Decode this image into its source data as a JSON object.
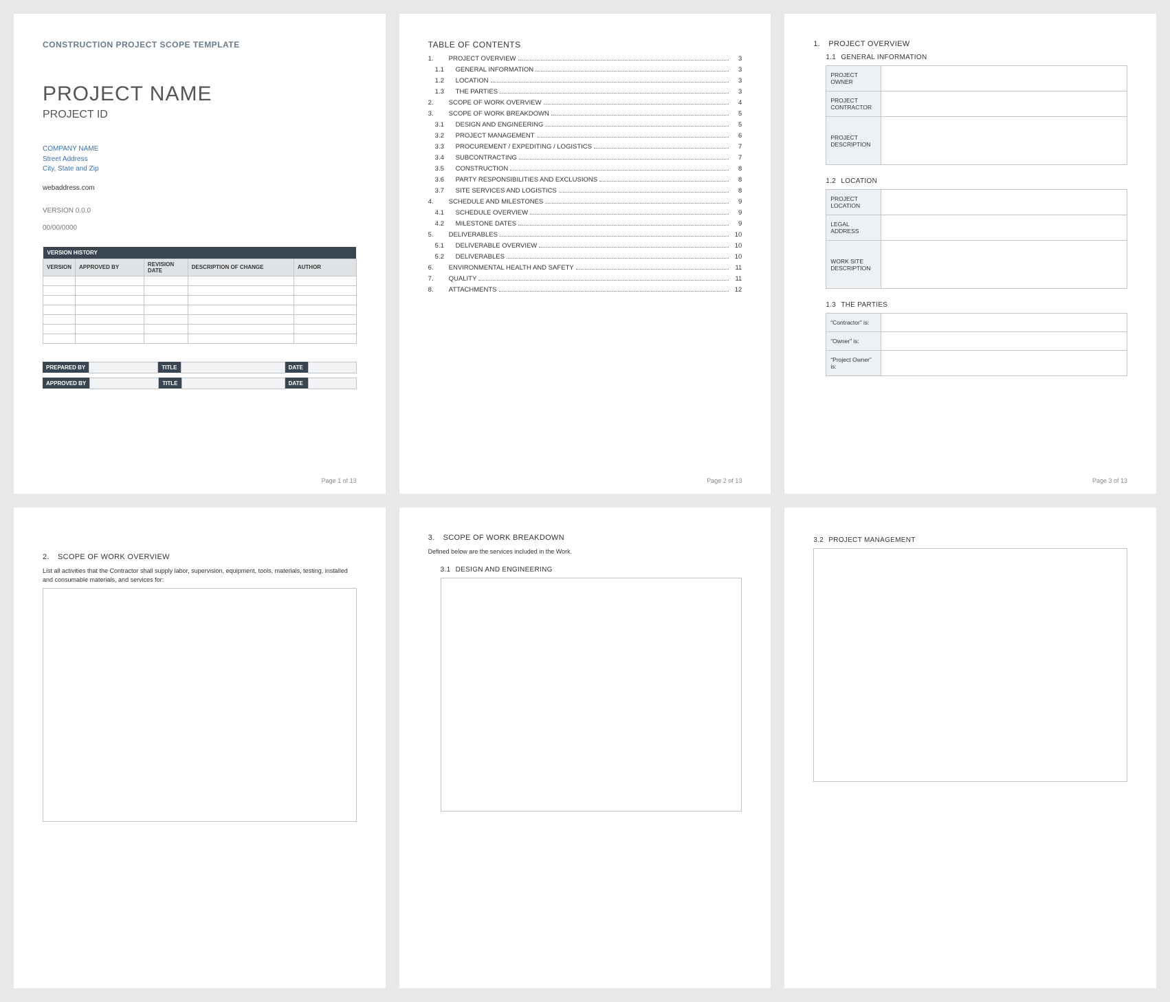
{
  "doc": {
    "type_header": "CONSTRUCTION PROJECT SCOPE TEMPLATE",
    "title": "PROJECT NAME",
    "project_id": "PROJECT ID",
    "company": {
      "name": "COMPANY NAME",
      "street": "Street Address",
      "city_state_zip": "City, State and Zip",
      "web": "webaddress.com"
    },
    "version": "VERSION 0.0.0",
    "date": "00/00/0000",
    "total_pages": 13
  },
  "version_history": {
    "bar": "VERSION HISTORY",
    "cols": [
      "VERSION",
      "APPROVED BY",
      "REVISION DATE",
      "DESCRIPTION OF CHANGE",
      "AUTHOR"
    ],
    "row_count": 7
  },
  "signoff": {
    "rows": [
      {
        "c0": "PREPARED BY",
        "c1": "TITLE",
        "c2": "DATE"
      },
      {
        "c0": "APPROVED BY",
        "c1": "TITLE",
        "c2": "DATE"
      }
    ]
  },
  "toc": {
    "title": "TABLE OF CONTENTS",
    "items": [
      {
        "n": "1.",
        "label": "PROJECT OVERVIEW",
        "pg": "3",
        "lvl": 0
      },
      {
        "n": "1.1",
        "label": "GENERAL INFORMATION",
        "pg": "3",
        "lvl": 1
      },
      {
        "n": "1.2",
        "label": "LOCATION",
        "pg": "3",
        "lvl": 1
      },
      {
        "n": "1.3",
        "label": "THE PARTIES",
        "pg": "3",
        "lvl": 1
      },
      {
        "n": "2.",
        "label": "SCOPE OF WORK OVERVIEW",
        "pg": "4",
        "lvl": 0
      },
      {
        "n": "3.",
        "label": "SCOPE OF WORK BREAKDOWN",
        "pg": "5",
        "lvl": 0
      },
      {
        "n": "3.1",
        "label": "DESIGN AND ENGINEERING",
        "pg": "5",
        "lvl": 1
      },
      {
        "n": "3.2",
        "label": "PROJECT MANAGEMENT",
        "pg": "6",
        "lvl": 1
      },
      {
        "n": "3.3",
        "label": "PROCUREMENT / EXPEDITING / LOGISTICS",
        "pg": "7",
        "lvl": 1
      },
      {
        "n": "3.4",
        "label": "SUBCONTRACTING",
        "pg": "7",
        "lvl": 1
      },
      {
        "n": "3.5",
        "label": "CONSTRUCTION",
        "pg": "8",
        "lvl": 1
      },
      {
        "n": "3.6",
        "label": "PARTY RESPONSIBILITIES AND EXCLUSIONS",
        "pg": "8",
        "lvl": 1
      },
      {
        "n": "3.7",
        "label": "SITE SERVICES AND LOGISTICS",
        "pg": "8",
        "lvl": 1
      },
      {
        "n": "4.",
        "label": "SCHEDULE AND MILESTONES",
        "pg": "9",
        "lvl": 0
      },
      {
        "n": "4.1",
        "label": "SCHEDULE OVERVIEW",
        "pg": "9",
        "lvl": 1
      },
      {
        "n": "4.2",
        "label": "MILESTONE DATES",
        "pg": "9",
        "lvl": 1
      },
      {
        "n": "5.",
        "label": "DELIVERABLES",
        "pg": "10",
        "lvl": 0
      },
      {
        "n": "5.1",
        "label": "DELIVERABLE OVERVIEW",
        "pg": "10",
        "lvl": 1
      },
      {
        "n": "5.2",
        "label": "DELIVERABLES",
        "pg": "10",
        "lvl": 1
      },
      {
        "n": "6.",
        "label": "ENVIRONMENTAL HEALTH AND SAFETY",
        "pg": "11",
        "lvl": 0
      },
      {
        "n": "7.",
        "label": "QUALITY",
        "pg": "11",
        "lvl": 0
      },
      {
        "n": "8.",
        "label": "ATTACHMENTS",
        "pg": "12",
        "lvl": 0
      }
    ]
  },
  "page3": {
    "h1_num": "1.",
    "h1": "PROJECT OVERVIEW",
    "s11_num": "1.1",
    "s11": "GENERAL INFORMATION",
    "s12_num": "1.2",
    "s12": "LOCATION",
    "s13_num": "1.3",
    "s13": "THE PARTIES",
    "general_rows": [
      {
        "label": "PROJECT OWNER"
      },
      {
        "label": "PROJECT CONTRACTOR"
      },
      {
        "label": "PROJECT DESCRIPTION",
        "tall": true
      }
    ],
    "location_rows": [
      {
        "label": "PROJECT LOCATION"
      },
      {
        "label": "LEGAL ADDRESS"
      },
      {
        "label": "WORK SITE DESCRIPTION",
        "tall": true
      }
    ],
    "parties_rows": [
      {
        "label": "“Contractor” is:"
      },
      {
        "label": "“Owner” is:"
      },
      {
        "label": "“Project Owner” is:"
      }
    ]
  },
  "page4": {
    "h_num": "2.",
    "h": "SCOPE OF WORK OVERVIEW",
    "desc": "List all activities that the Contractor shall supply labor, supervision, equipment, tools, materials, testing, installed and consumable materials, and services for:"
  },
  "page5": {
    "h_num": "3.",
    "h": "SCOPE OF WORK BREAKDOWN",
    "desc": "Defined below are the services included in the Work.",
    "s_num": "3.1",
    "s": "DESIGN AND ENGINEERING"
  },
  "page6": {
    "s_num": "3.2",
    "s": "PROJECT MANAGEMENT"
  },
  "footers": {
    "p1": "Page 1 of 13",
    "p2": "Page 2 of 13",
    "p3": "Page 3 of 13"
  }
}
